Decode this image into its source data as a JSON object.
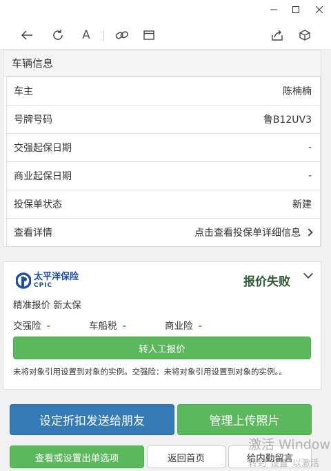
{
  "window": {
    "controls": [
      "minimize",
      "maximize",
      "close"
    ]
  },
  "toolbar": {
    "icons": [
      "back-icon",
      "refresh-icon",
      "font-icon",
      "link-icon",
      "window-icon",
      "share-icon",
      "cube-icon"
    ],
    "font_glyph": "A"
  },
  "vehicle": {
    "title": "车辆信息",
    "rows": [
      {
        "label": "车主",
        "value": "陈楠楠"
      },
      {
        "label": "号牌号码",
        "value": "鲁B12UV3"
      },
      {
        "label": "交强起保日期",
        "value": "-"
      },
      {
        "label": "商业起保日期",
        "value": "-"
      },
      {
        "label": "投保单状态",
        "value": "新建"
      },
      {
        "label": "查看详情",
        "value": "点击查看投保单详细信息"
      }
    ]
  },
  "quote": {
    "logo_cn": "太平洋保险",
    "logo_en": "CPIC",
    "status": "报价失败",
    "subtitle": "精准报价 新太保",
    "items": [
      {
        "label": "交强险",
        "value": "-"
      },
      {
        "label": "车船税",
        "value": "-"
      },
      {
        "label": "商业险",
        "value": "-"
      }
    ],
    "manual_button": "转人工报价",
    "note": "未将对象引用设置到对象的实例。交强险：未将对象引用设置到对象的实例。。"
  },
  "actions": {
    "send_friend": "设定折扣发送给朋友",
    "upload_photos": "管理上传照片",
    "set_options": "查看或设置出单选项",
    "back_home": "返回首页",
    "leave_message": "给内勤留言"
  },
  "watermark": {
    "line1": "激活 Windows",
    "line2": "转到\"设置\"以激活"
  },
  "colors": {
    "primary_blue": "#337ab7",
    "success_green": "#5cb85c",
    "status_text": "#2e5a36",
    "brand_blue": "#1f4ea3"
  }
}
